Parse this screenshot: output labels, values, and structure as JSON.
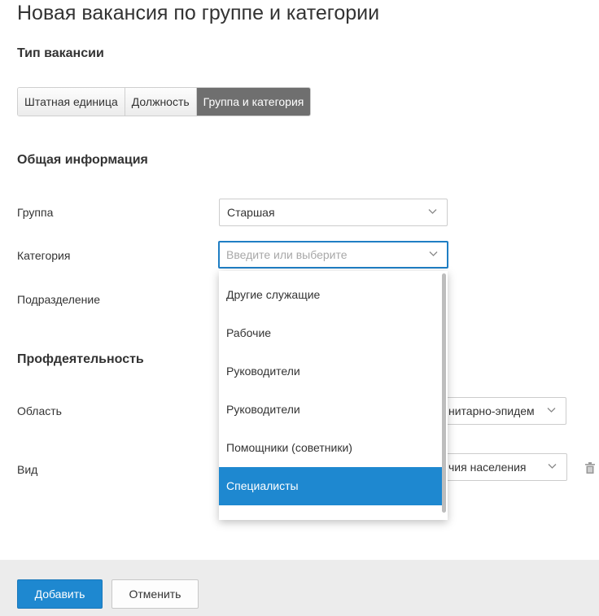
{
  "page": {
    "title": "Новая вакансия по группе и категории"
  },
  "vacancy_type": {
    "heading": "Тип вакансии",
    "options": [
      "Штатная единица",
      "Должность",
      "Группа и категория"
    ],
    "active_index": 2
  },
  "general": {
    "heading": "Общая информация",
    "group_label": "Группа",
    "group_value": "Старшая",
    "category_label": "Категория",
    "category_placeholder": "Введите или выберите",
    "department_label": "Подразделение",
    "category_options": [
      "Другие служащие",
      "Рабочие",
      "Руководители",
      "Руководители",
      "Помощники (советники)",
      "Специалисты"
    ],
    "category_selected": "Специалисты"
  },
  "activity": {
    "heading": "Профдеятельность",
    "area_label": "Область",
    "area_value_visible": "нитарно-эпидем",
    "kind_label": "Вид",
    "kind_value_visible": "чия населения"
  },
  "footer": {
    "add_label": "Добавить",
    "cancel_label": "Отменить"
  },
  "icons": {
    "chevron": "chevron-down-icon",
    "trash": "trash-icon"
  },
  "colors": {
    "primary": "#1e88d0",
    "segment_active": "#6f6f6f",
    "focus_border": "#1f7ec4"
  }
}
